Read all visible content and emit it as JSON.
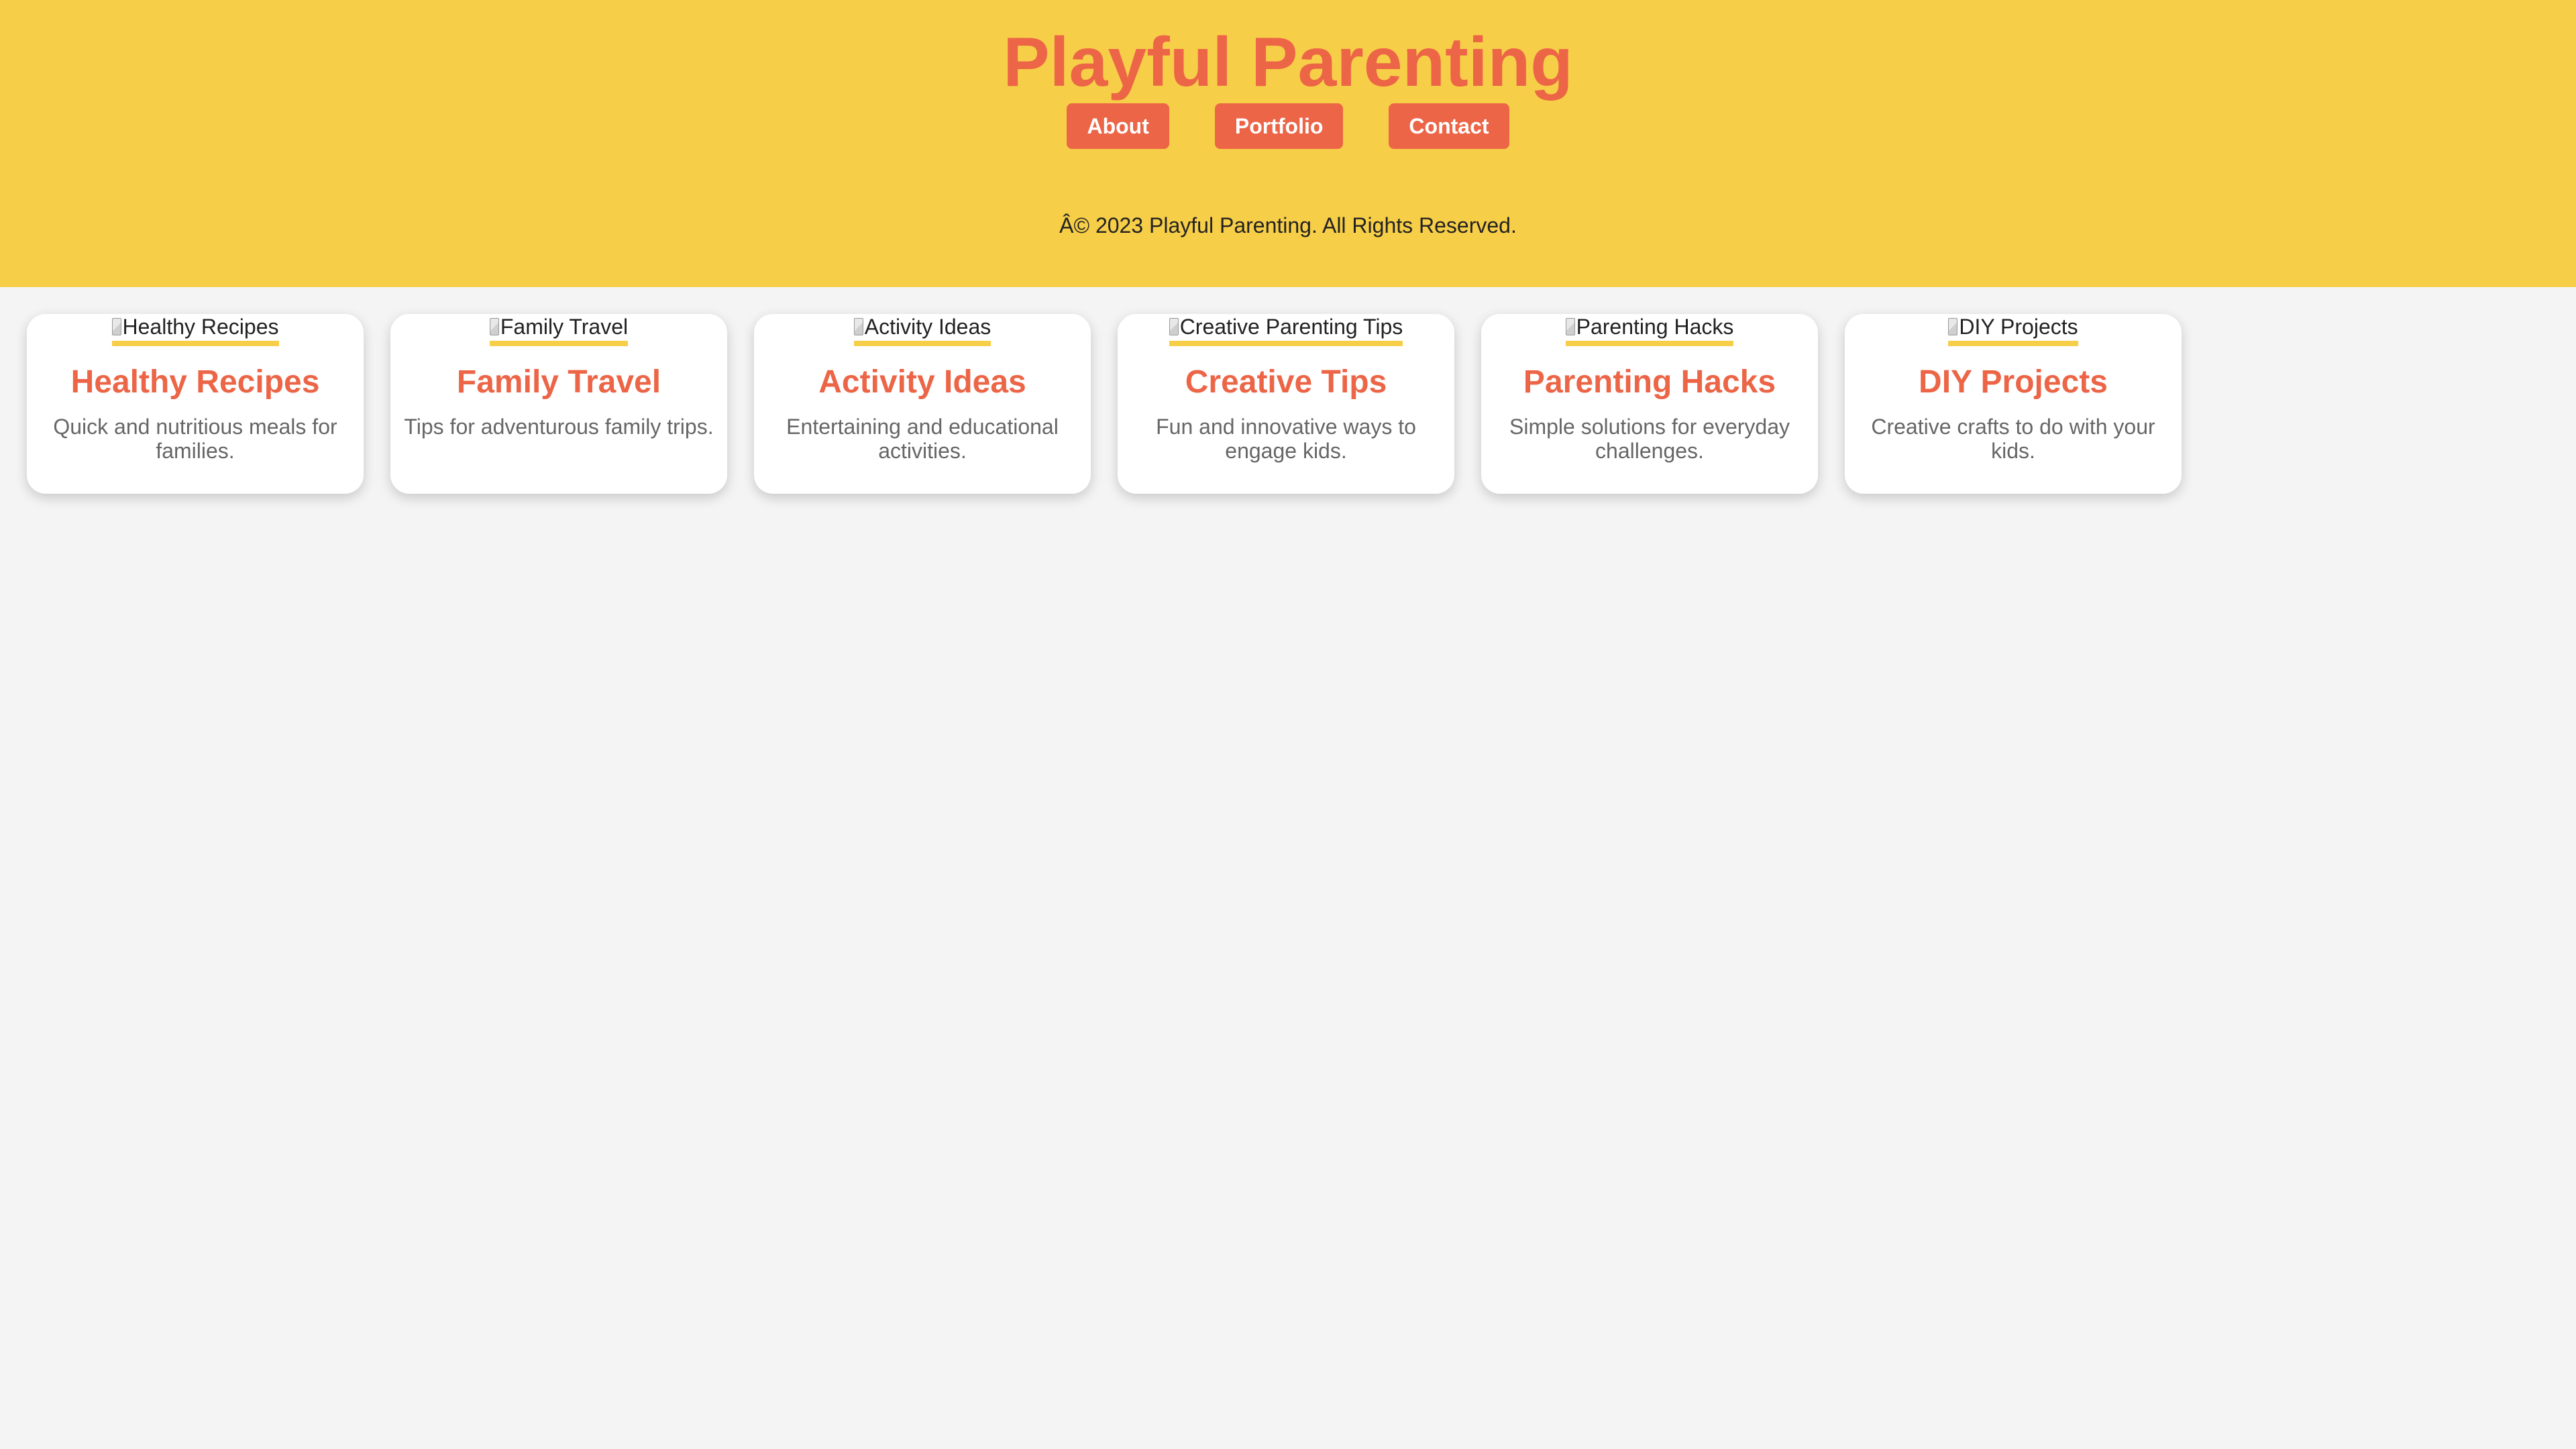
{
  "header": {
    "title": "Playful Parenting",
    "nav": [
      {
        "label": "About"
      },
      {
        "label": "Portfolio"
      },
      {
        "label": "Contact"
      }
    ],
    "footer": "Â© 2023 Playful Parenting. All Rights Reserved."
  },
  "cards": [
    {
      "image_alt": "Healthy Recipes",
      "title": "Healthy Recipes",
      "description": "Quick and nutritious meals for families."
    },
    {
      "image_alt": "Family Travel",
      "title": "Family Travel",
      "description": "Tips for adventurous family trips."
    },
    {
      "image_alt": "Activity Ideas",
      "title": "Activity Ideas",
      "description": "Entertaining and educational activities."
    },
    {
      "image_alt": "Creative Parenting Tips",
      "title": "Creative Tips",
      "description": "Fun and innovative ways to engage kids."
    },
    {
      "image_alt": "Parenting Hacks",
      "title": "Parenting Hacks",
      "description": "Simple solutions for everyday challenges."
    },
    {
      "image_alt": "DIY Projects",
      "title": "DIY Projects",
      "description": "Creative crafts to do with your kids."
    }
  ],
  "colors": {
    "header_background": "#f7ce48",
    "accent": "#ec6547",
    "page_background": "#f4f4f4",
    "card_background": "#ffffff",
    "description_text": "#666666"
  },
  "icons": {
    "card_image": "broken-image-icon"
  }
}
